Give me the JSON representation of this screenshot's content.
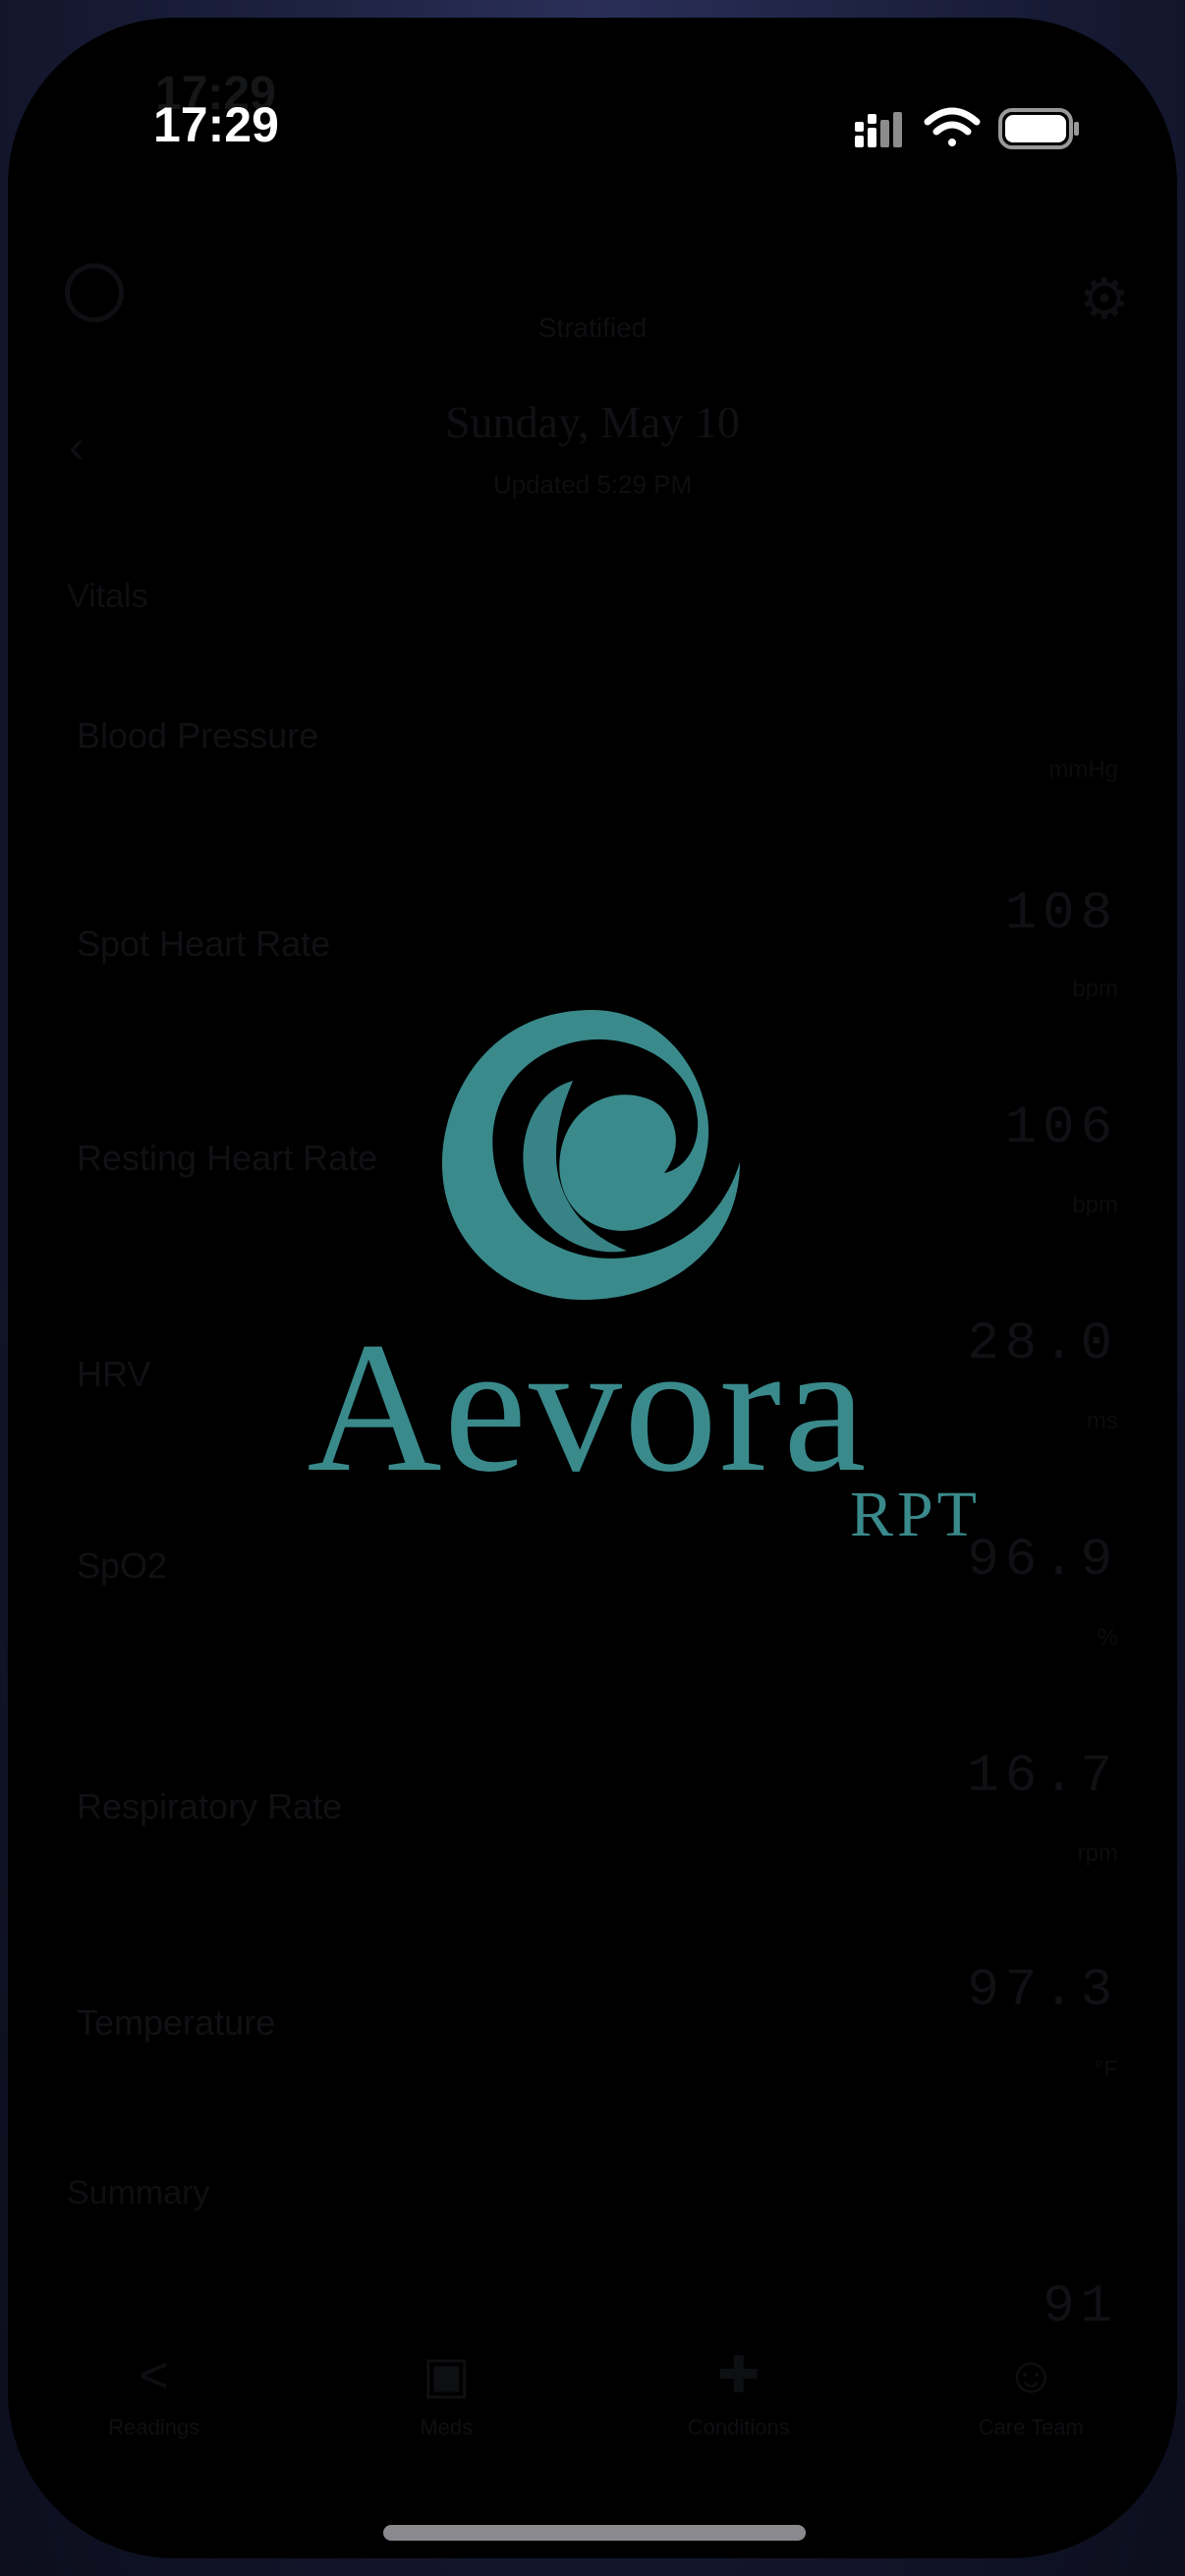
{
  "status_bar": {
    "time": "17:29"
  },
  "app": {
    "ghost_time": "17:29",
    "header": {
      "center_label": "Stratified"
    },
    "date_title": "Sunday, May 10",
    "updated": "Updated 5:29 PM",
    "sections": {
      "vitals": "Vitals",
      "second": "Summary"
    },
    "metrics": [
      {
        "label": "Blood Pressure",
        "sub": "",
        "value": "",
        "unit": "mmHg"
      },
      {
        "label": "Spot Heart Rate",
        "sub": "",
        "value": "108",
        "unit": "bpm"
      },
      {
        "label": "Resting Heart Rate",
        "sub": "",
        "value": "106",
        "unit": "bpm"
      },
      {
        "label": "HRV",
        "sub": "",
        "value": "28.0",
        "unit": "ms"
      },
      {
        "label": "SpO2",
        "sub": "",
        "value": "96.9",
        "unit": "%"
      },
      {
        "label": "Respiratory Rate",
        "sub": "",
        "value": "16.7",
        "unit": "rpm"
      },
      {
        "label": "Temperature",
        "sub": "",
        "value": "97.3",
        "unit": "°F"
      }
    ],
    "bottom_value": "91",
    "tabs": [
      {
        "label": "Readings",
        "icon": "share-icon"
      },
      {
        "label": "Meds",
        "icon": "calendar-icon"
      },
      {
        "label": "Conditions",
        "icon": "medkit-icon"
      },
      {
        "label": "Care Team",
        "icon": "people-icon"
      }
    ]
  },
  "splash": {
    "brand": "Aevora",
    "tagline": "RPT",
    "brand_color": "#3a8a8c"
  }
}
